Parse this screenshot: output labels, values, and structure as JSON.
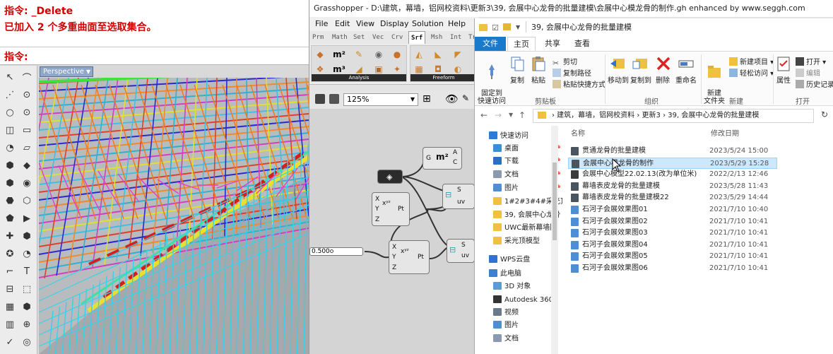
{
  "rhino": {
    "command_history": [
      "指令: _Delete",
      "已加入 2 个多重曲面至选取集合。"
    ],
    "command_prompt": "指令:",
    "viewport_tab": "Perspective"
  },
  "grasshopper": {
    "title": "Grasshopper - D:\\建筑，幕墙，铝网校资料\\更新3\\39, 会展中心龙骨的批量建模\\会展中心模龙骨的制作.gh   enhanced by www.seggh.com",
    "menu": [
      "File",
      "Edit",
      "View",
      "Display",
      "Solution",
      "Help"
    ],
    "tabs": [
      "Prm",
      "Math",
      "Set",
      "Vec",
      "Crv",
      "Srf",
      "Msh",
      "Int",
      "Tr"
    ],
    "active_tab": "Srf",
    "groups": [
      "Analysis",
      "Freeform"
    ],
    "zoom": "125%",
    "slider_value": "0.500",
    "node_ports": {
      "area_in": "G",
      "area_out_a": "A",
      "area_out_c": "C",
      "pt_x": "X",
      "pt_y": "Y",
      "pt_z": "Z",
      "pt_out": "Pt",
      "eval_s": "S",
      "eval_uv": "uv"
    }
  },
  "explorer": {
    "title": "39, 会展中心龙骨的批量建模",
    "ribbon_tabs": [
      "文件",
      "主页",
      "共享",
      "查看"
    ],
    "active_tab": "主页",
    "ribbon": {
      "pin_label": "固定到\n快速访问",
      "copy": "复制",
      "paste": "粘贴",
      "cut": "剪切",
      "copy_path": "复制路径",
      "paste_shortcut": "粘贴快捷方式",
      "clipboard_group": "剪贴板",
      "move_to": "移动到",
      "copy_to": "复制到",
      "delete": "删除",
      "rename": "重命名",
      "organize_group": "组织",
      "new_folder": "新建\n文件夹",
      "new_item": "新建项目",
      "easy_access": "轻松访问",
      "new_group": "新建",
      "properties": "属性",
      "open": "打开",
      "edit": "编辑",
      "history": "历史记录",
      "open_group": "打开"
    },
    "address_path": "› 建筑，幕墙，铝网校资料 › 更新3 › 39, 会展中心龙骨的批量建模",
    "nav": [
      {
        "label": "快速访问",
        "icon": "star-icon",
        "color": "#2e7bd6"
      },
      {
        "label": "桌面",
        "icon": "desktop-icon",
        "color": "#3a8fd8",
        "pin": true
      },
      {
        "label": "下载",
        "icon": "download-icon",
        "color": "#2c6fc0",
        "pin": true
      },
      {
        "label": "文档",
        "icon": "document-icon",
        "color": "#8a9bb0",
        "pin": true
      },
      {
        "label": "图片",
        "icon": "pictures-icon",
        "color": "#4f8fcf",
        "pin": true
      },
      {
        "label": "1#2#3#4#采光顶",
        "icon": "folder-icon",
        "color": "#f0c040"
      },
      {
        "label": "39, 会展中心龙骨",
        "icon": "folder-icon",
        "color": "#f0c040"
      },
      {
        "label": "UWC最新幕墙图",
        "icon": "folder-icon",
        "color": "#f0c040"
      },
      {
        "label": "采光顶模型",
        "icon": "folder-icon",
        "color": "#f0c040"
      },
      {
        "label": "WPS云盘",
        "icon": "cloud-icon",
        "color": "#2f72d0"
      },
      {
        "label": "此电脑",
        "icon": "computer-icon",
        "color": "#3d7fd0"
      },
      {
        "label": "3D 对象",
        "icon": "3d-objects-icon",
        "color": "#5b9bd8"
      },
      {
        "label": "Autodesk 360",
        "icon": "cloud-icon",
        "color": "#333333"
      },
      {
        "label": "视频",
        "icon": "video-icon",
        "color": "#6a7a8a"
      },
      {
        "label": "图片",
        "icon": "pictures-icon",
        "color": "#4f8fcf"
      },
      {
        "label": "文档",
        "icon": "document-icon",
        "color": "#8a9bb0"
      }
    ],
    "columns": {
      "name": "名称",
      "modified": "修改日期"
    },
    "files": [
      {
        "name": "贯通龙骨的批量建模",
        "date": "2023/5/24 15:00",
        "icon": "grasshopper-file-icon",
        "color": "#4a5560"
      },
      {
        "name": "会展中心横龙骨的制作",
        "date": "2023/5/29 15:28",
        "icon": "grasshopper-file-icon",
        "color": "#4a5560",
        "selected": true
      },
      {
        "name": "会展中心模型22.02.13(改为单位米)",
        "date": "2022/2/13 12:46",
        "icon": "rhino-file-icon",
        "color": "#3a3a3a"
      },
      {
        "name": "幕墙表皮龙骨的批量建模",
        "date": "2023/5/28 11:43",
        "icon": "grasshopper-file-icon",
        "color": "#4a5560"
      },
      {
        "name": "幕墙表皮龙骨的批量建模22",
        "date": "2023/5/29 14:44",
        "icon": "grasshopper-file-icon",
        "color": "#4a5560"
      },
      {
        "name": "石河子会展效果图01",
        "date": "2021/7/10 10:40",
        "icon": "image-file-icon",
        "color": "#4e8fd4"
      },
      {
        "name": "石河子会展效果图02",
        "date": "2021/7/10 10:41",
        "icon": "image-file-icon",
        "color": "#4e8fd4"
      },
      {
        "name": "石河子会展效果图03",
        "date": "2021/7/10 10:41",
        "icon": "image-file-icon",
        "color": "#4e8fd4"
      },
      {
        "name": "石河子会展效果图04",
        "date": "2021/7/10 10:41",
        "icon": "image-file-icon",
        "color": "#4e8fd4"
      },
      {
        "name": "石河子会展效果图05",
        "date": "2021/7/10 10:41",
        "icon": "image-file-icon",
        "color": "#4e8fd4"
      },
      {
        "name": "石河子会展效果图06",
        "date": "2021/7/10 10:41",
        "icon": "image-file-icon",
        "color": "#4e8fd4"
      }
    ]
  }
}
